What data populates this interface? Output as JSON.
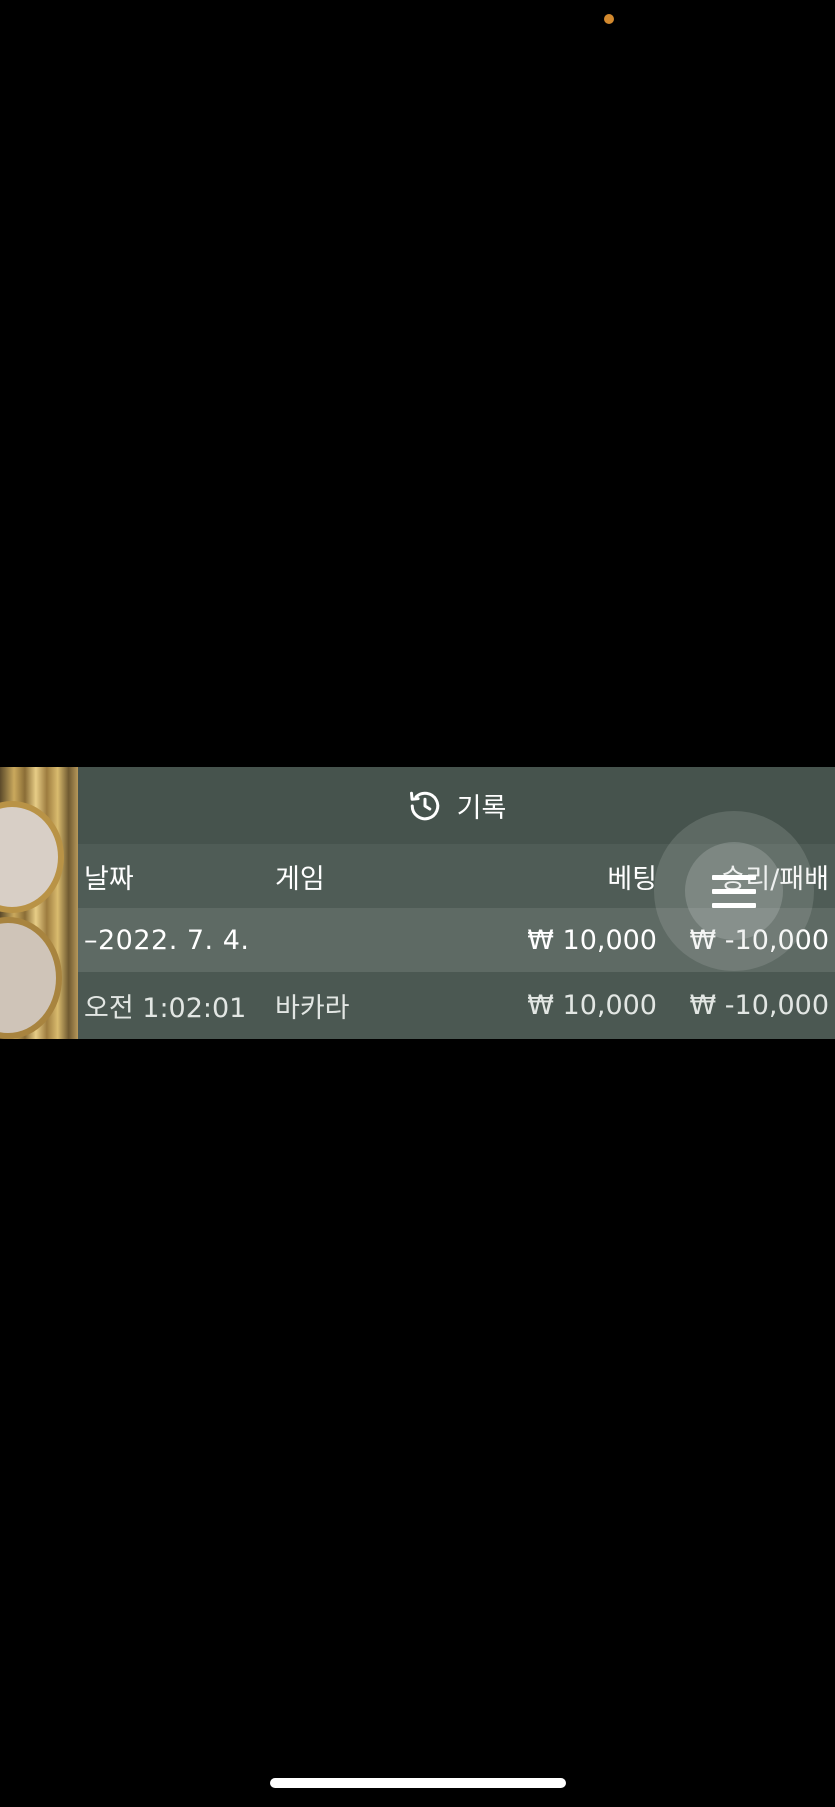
{
  "panel": {
    "title": "기록",
    "title_icon": "history-icon"
  },
  "columns": {
    "date": "날짜",
    "game": "게임",
    "bet": "베팅",
    "result": "승리/패배"
  },
  "date_group": {
    "label": "–2022. 7. 4.",
    "bet": "₩ 10,000",
    "result": "₩ -10,000"
  },
  "entries": [
    {
      "time": "오전 1:02:01",
      "game": "바카라",
      "bet": "₩ 10,000",
      "result": "₩ -10,000"
    }
  ],
  "fab": {
    "icon": "menu-icon"
  },
  "colors": {
    "background": "#000000",
    "panel": "#4b5852",
    "camera_dot": "#d3892e"
  }
}
